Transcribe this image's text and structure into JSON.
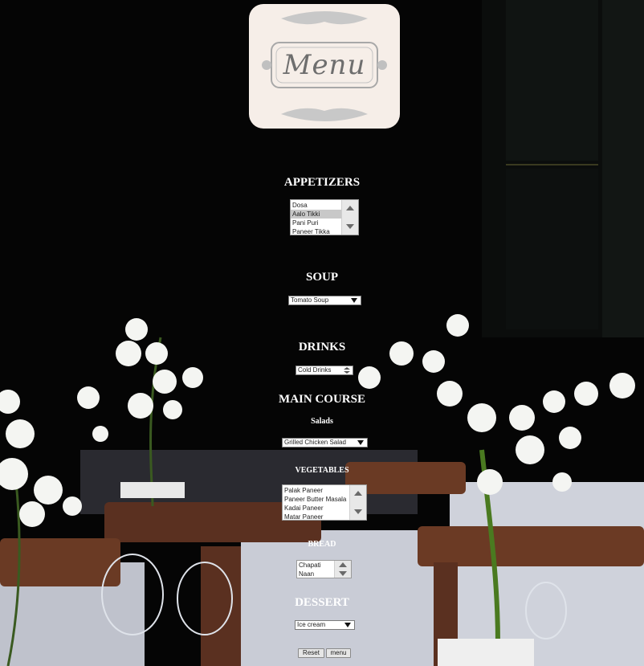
{
  "logo": {
    "text": "Menu"
  },
  "sections": {
    "appetizers": {
      "heading": "APPETIZERS",
      "options": [
        "Dosa",
        "Aalo Tikki",
        "Pani Puri",
        "Paneer Tikka"
      ],
      "selected_index": 1
    },
    "soup": {
      "heading": "SOUP",
      "value": "Tomato Soup"
    },
    "drinks": {
      "heading": "DRINKS",
      "value": "Cold Drinks"
    },
    "main_course": {
      "heading": "MAIN COURSE",
      "salads": {
        "label": "Salads",
        "value": "Grilled Chicken Salad"
      },
      "vegetables": {
        "label": "VEGETABLES",
        "options": [
          "Palak Paneer",
          "Paneer Butter Masala",
          "Kadai Paneer",
          "Matar Paneer"
        ]
      },
      "bread": {
        "label": "BREAD",
        "options": [
          "Chapati",
          "Naan"
        ]
      }
    },
    "dessert": {
      "heading": "DESSERT",
      "value": "Ice cream"
    }
  },
  "buttons": {
    "reset": "Reset",
    "menu": "menu"
  },
  "colors": {
    "background": "#050505",
    "heading_text": "#ffffff",
    "logo_card": "#f6eee8"
  }
}
